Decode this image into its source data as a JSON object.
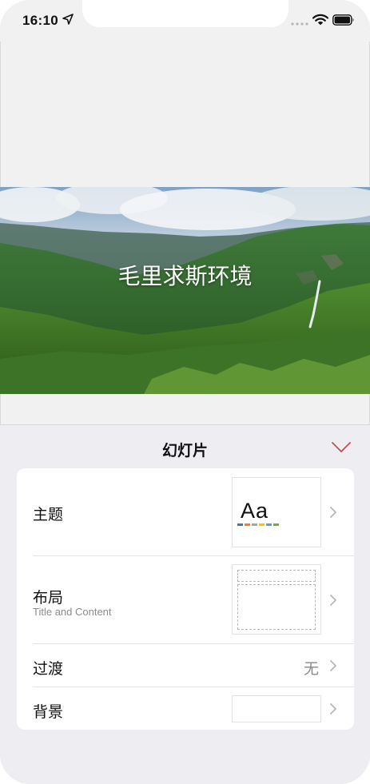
{
  "status_bar": {
    "time": "16:10"
  },
  "slide": {
    "title": "毛里求斯环境"
  },
  "panel": {
    "title": "幻灯片",
    "rows": [
      {
        "label": "主题",
        "thumbnail_text": "Aa"
      },
      {
        "label": "布局",
        "sublabel": "Title and Content"
      },
      {
        "label": "过渡",
        "value": "无"
      },
      {
        "label": "背景"
      }
    ]
  },
  "colors": {
    "accent": "#c0504d",
    "theme_swatches": [
      "#4472c4",
      "#ed7d31",
      "#a5a5a5",
      "#ffc000",
      "#5b9bd5",
      "#70ad47"
    ]
  },
  "icons": [
    "location-arrow-icon",
    "signal-dots-icon",
    "wifi-icon",
    "battery-icon",
    "chevron-down-icon",
    "chevron-right-icon"
  ]
}
